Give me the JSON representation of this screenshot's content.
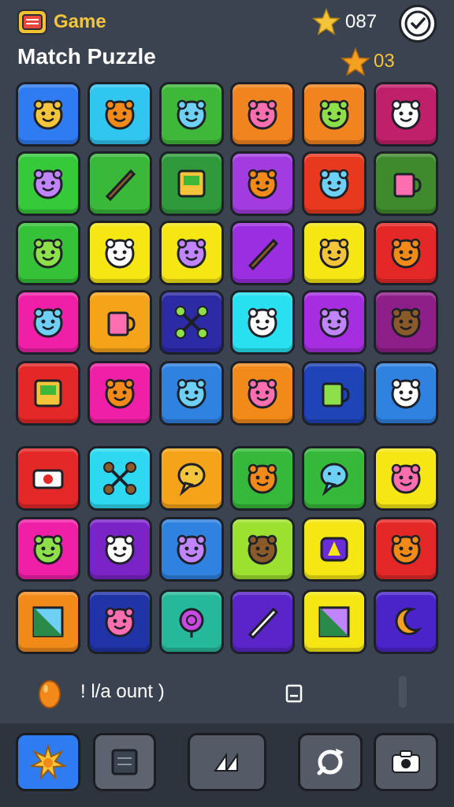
{
  "header": {
    "app_name": "Game",
    "title": "Match Puzzle",
    "score": "087",
    "moves": "03"
  },
  "status": {
    "count_label": "! l/a ount )"
  },
  "colors": {
    "background": "#3b4350",
    "accent_yellow": "#f4c43a"
  },
  "tiles": [
    {
      "color": "#2f7cf2",
      "icon": "mushroom-creature-icon"
    },
    {
      "color": "#31c6f0",
      "icon": "yellow-blob-icon"
    },
    {
      "color": "#3fb83a",
      "icon": "orange-face-icon"
    },
    {
      "color": "#f2841f",
      "icon": "bear-face-icon"
    },
    {
      "color": "#f2841f",
      "icon": "white-ghost-icon"
    },
    {
      "color": "#c01f6a",
      "icon": "spiky-puff-icon"
    },
    {
      "color": "#36c93a",
      "icon": "blue-creature-icon"
    },
    {
      "color": "#39b83a",
      "icon": "pencil-icon"
    },
    {
      "color": "#2f9a3c",
      "icon": "green-frame-face-icon"
    },
    {
      "color": "#a23ce0",
      "icon": "blue-cat-icon"
    },
    {
      "color": "#e8391f",
      "icon": "fox-face-icon"
    },
    {
      "color": "#3e8a2c",
      "icon": "cupcake-icon"
    },
    {
      "color": "#35c238",
      "icon": "squid-icon"
    },
    {
      "color": "#f5e614",
      "icon": "orange-ball-face-icon"
    },
    {
      "color": "#f5e614",
      "icon": "hamster-face-icon"
    },
    {
      "color": "#9a2ee0",
      "icon": "leaf-icon"
    },
    {
      "color": "#f5e614",
      "icon": "gray-bear-icon"
    },
    {
      "color": "#e42828",
      "icon": "orange-blob-icon"
    },
    {
      "color": "#f01fa8",
      "icon": "white-cat-icon"
    },
    {
      "color": "#f5a41a",
      "icon": "bucket-icon"
    },
    {
      "color": "#2d2aa6",
      "icon": "tools-icon"
    },
    {
      "color": "#28e0f0",
      "icon": "pink-blob-icon"
    },
    {
      "color": "#a62ee0",
      "icon": "unicorn-face-icon"
    },
    {
      "color": "#8e1f88",
      "icon": "blue-ghost-icon"
    },
    {
      "color": "#e42828",
      "icon": "notebook-icon"
    },
    {
      "color": "#f01fa8",
      "icon": "corgi-face-icon"
    },
    {
      "color": "#2f82e0",
      "icon": "green-monster-icon"
    },
    {
      "color": "#f28a1a",
      "icon": "octopus-icon"
    },
    {
      "color": "#1f44b8",
      "icon": "mug-icon"
    },
    {
      "color": "#2f82e0",
      "icon": "frog-face-icon"
    },
    {
      "color": "#e42828",
      "icon": "camera-icon"
    },
    {
      "color": "#2ed8f0",
      "icon": "molecule-icon"
    },
    {
      "color": "#f5a41a",
      "icon": "speech-bubble-brown-icon"
    },
    {
      "color": "#36b83a",
      "icon": "mouse-icon"
    },
    {
      "color": "#36b83a",
      "icon": "speech-bubble-yellow-icon"
    },
    {
      "color": "#f5e614",
      "icon": "green-smiley-icon"
    },
    {
      "color": "#f01fa8",
      "icon": "pink-bear-icon"
    },
    {
      "color": "#7a24c8",
      "icon": "lion-face-icon"
    },
    {
      "color": "#2f82e0",
      "icon": "blue-bear-icon"
    },
    {
      "color": "#9ce030",
      "icon": "pink-pig-icon"
    },
    {
      "color": "#f5e614",
      "icon": "letter-a-block-icon"
    },
    {
      "color": "#e42828",
      "icon": "orange-cat-icon"
    },
    {
      "color": "#f28a1a",
      "icon": "green-triangle-icon"
    },
    {
      "color": "#2034a8",
      "icon": "yellow-lion-icon"
    },
    {
      "color": "#26b89a",
      "icon": "lollipop-icon"
    },
    {
      "color": "#5a24c8",
      "icon": "paper-plane-icon"
    },
    {
      "color": "#f5e614",
      "icon": "pink-diamond-icon"
    },
    {
      "color": "#4a24c8",
      "icon": "moon-icon"
    }
  ],
  "toolbar": [
    {
      "name": "burst-button",
      "color": "#2f7cf2",
      "icon": "sunburst-icon"
    },
    {
      "name": "board-button",
      "color": "#5d6470",
      "icon": "notepad-icon"
    },
    {
      "name": "rewind-button",
      "color": "#545b67",
      "icon": "rewind-icon"
    },
    {
      "name": "refresh-button",
      "color": "#545b67",
      "icon": "refresh-icon"
    },
    {
      "name": "camera-button",
      "color": "#545b67",
      "icon": "camera-icon"
    }
  ]
}
